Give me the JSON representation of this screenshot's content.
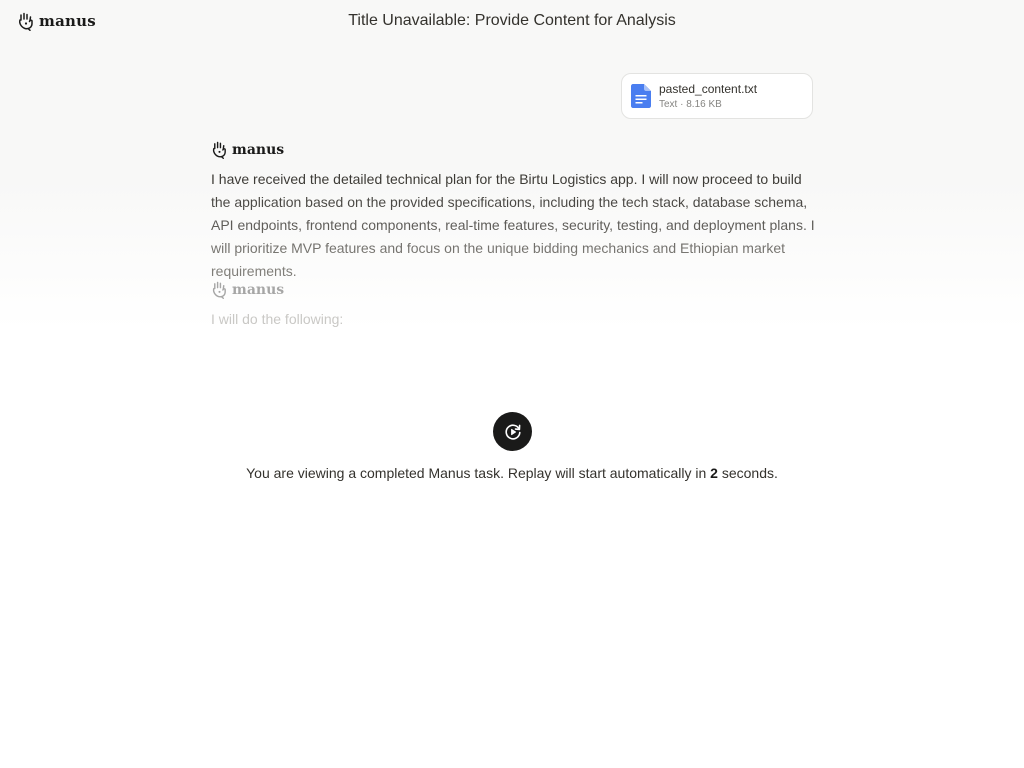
{
  "header": {
    "brand_name": "manus",
    "brand_icon": "manus-hand-icon",
    "title": "Title Unavailable: Provide Content for Analysis"
  },
  "attachment": {
    "file_name": "pasted_content.txt",
    "file_info": "Text · 8.16 KB",
    "icon": "document-icon",
    "icon_color": "#4a7ef0"
  },
  "messages": [
    {
      "author": "manus",
      "text": "I have received the detailed technical plan for the Birtu Logistics app. I will now proceed to build the application based on the provided specifications, including the tech stack, database schema, API endpoints, frontend components, real-time features, security, testing, and deployment plans. I will prioritize MVP features and focus on the unique bidding mechanics and Ethiopian market requirements."
    },
    {
      "author": "manus",
      "text": "I will do the following:"
    }
  ],
  "replay": {
    "icon": "replay-icon",
    "text_before": "You are viewing a completed Manus task. Replay will start automatically in ",
    "seconds": "2",
    "text_after": " seconds."
  }
}
